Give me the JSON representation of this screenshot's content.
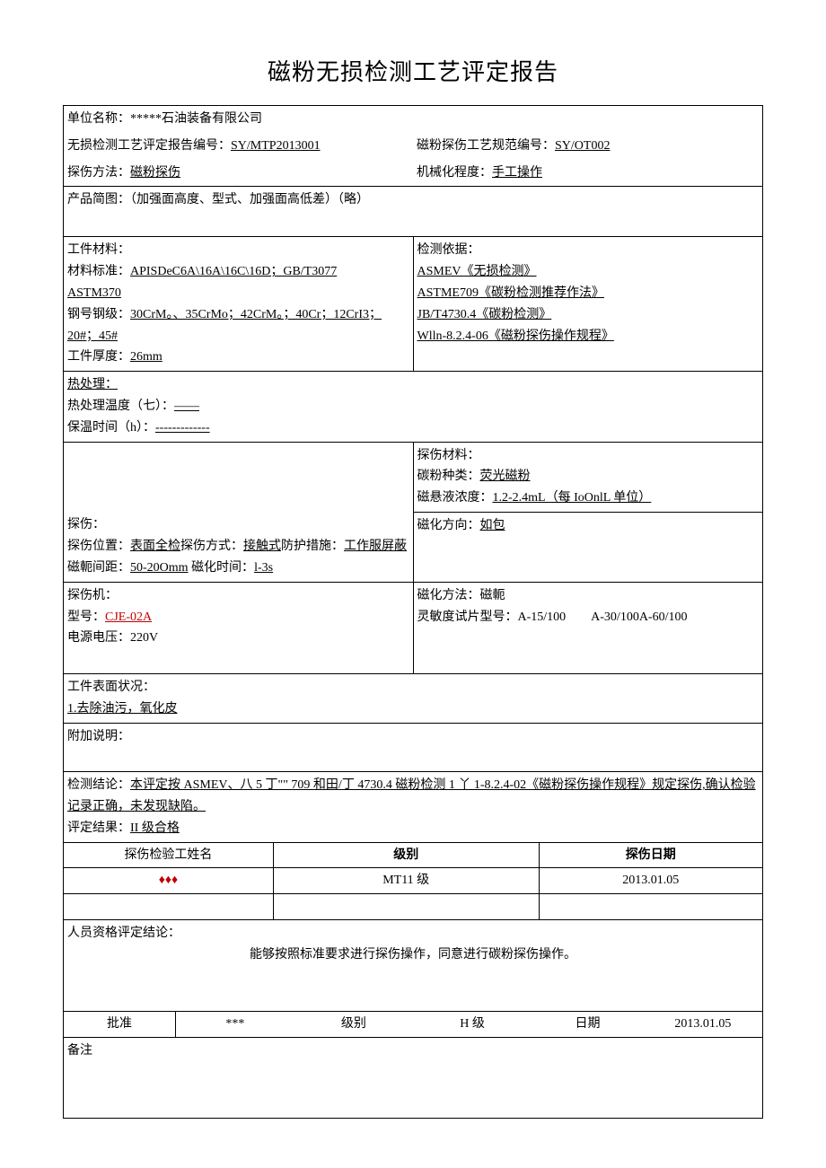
{
  "title": "磁粉无损检测工艺评定报告",
  "header": {
    "company_label": "单位名称：",
    "company_value": "*****石油装备有限公司",
    "report_no_label": "无损检测工艺评定报告编号：",
    "report_no_value": "SY/MTP2013001",
    "spec_no_label": "磁粉探伤工艺规范编号：",
    "spec_no_value": "SY/OT002",
    "method_label": "探伤方法：",
    "method_value": "磁粉探伤",
    "mech_label": "机械化程度：",
    "mech_value": "手工操作",
    "sketch_label": "产品简图：（加强面高度、型式、加强面高低差）（略）"
  },
  "workpiece": {
    "material_label": "工件材料：",
    "std_label": "材料标准：",
    "std_value": "APISDeC6A\\16A\\16C\\16D；GB/T3077",
    "std_value2": "ASTM370",
    "grade_label": "钢号钢级：",
    "grade_value": "30CrM。、35CrMo；42CrM。；40Cr；12CrI3；20#；45#",
    "thickness_label": "工件厚度：",
    "thickness_value": "26mm"
  },
  "basis": {
    "label": "检测依据：",
    "l1": "ASMEV《无损检测》",
    "l2": "ASTME709《碳粉检测推荐作法》",
    "l3": "JB/T4730.4《碳粉检测》",
    "l4": "Wlln-8.2.4-06《磁粉探伤操作规程》"
  },
  "heat": {
    "label": "热处理：",
    "temp_label": "热处理温度（七）：",
    "temp_value": "——",
    "hold_label": "保温时间（h）：",
    "hold_value": "-------------"
  },
  "mat": {
    "label": "探伤材料：",
    "powder_label": "碳粉种类：",
    "powder_value": "荧光磁粉",
    "conc_label": "磁悬液浓度：",
    "conc_value": "1.2-2.4mL（每 IoOnlL 单位）"
  },
  "inspect": {
    "label": "探伤：",
    "pos_label": "探伤位置：",
    "pos_value": "表面全检",
    "mode_label": "探伤方式：",
    "mode_value": "接触式",
    "prot_label": "防护措施：",
    "prot_value": "工作服屏蔽",
    "yoke_label": "磁軛间距：",
    "yoke_value": "50-20Omm",
    "time_label": "磁化时间：",
    "time_value": "l-3s",
    "dir_label": "磁化方向：",
    "dir_value": "如包"
  },
  "machine": {
    "label": "探伤机：",
    "model_label": "型号：",
    "model_value": "CJE-02A",
    "volt_label": "电源电压：220V",
    "method_label": "磁化方法：磁軛",
    "sens_label": "灵敏度试片型号：A-15/100　　A-30/100A-60/100"
  },
  "surface": {
    "label": "工件表面状况：",
    "l1": "1.去除油污，氧化皮"
  },
  "addl_label": "附加说明：",
  "conclusion": {
    "label": "检测结论：",
    "text": "本评定按 ASMEV、八 5 丁\"\" 709 和田/丁 4730.4 磁粉检测 1 丫 1-8.2.4-02《磁粉探伤操作规程》规定探伤,确认检验记录正确，未发现缺陷。",
    "result_label": "评定结果：",
    "result_value": "II 级合格"
  },
  "sig": {
    "h1": "探伤检验工姓名",
    "h2": "级别",
    "h3": "探伤日期",
    "name": "♦♦♦",
    "level": "MT11 级",
    "date": "2013.01.05"
  },
  "qual": {
    "label": "人员资格评定结论：",
    "text": "能够按照标准要求进行探伤操作，同意进行碳粉探伤操作。"
  },
  "approve": {
    "h1": "批准",
    "v1": "***",
    "h2": "级别",
    "v2": "H 级",
    "h3": "日期",
    "v3": "2013.01.05"
  },
  "notes_label": "备注"
}
